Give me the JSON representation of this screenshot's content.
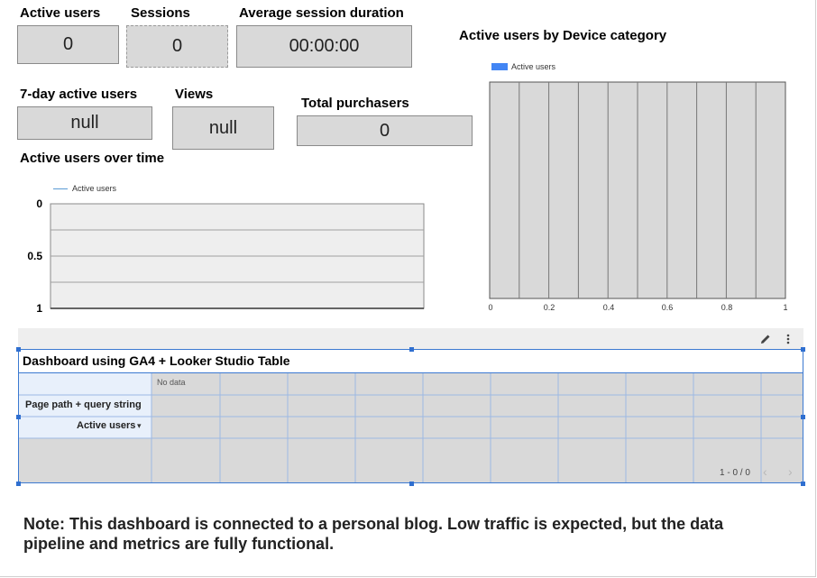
{
  "scorecards": {
    "active_users": {
      "label": "Active users",
      "value": "0"
    },
    "sessions": {
      "label": "Sessions",
      "value": "0"
    },
    "avg_session_duration": {
      "label": "Average session duration",
      "value": "00:00:00"
    },
    "seven_day_active_users": {
      "label": "7-day active users",
      "value": "null"
    },
    "views": {
      "label": "Views",
      "value": "null"
    },
    "total_purchasers": {
      "label": "Total purchasers",
      "value": "0"
    }
  },
  "line_chart": {
    "title": "Active users over time",
    "legend": "Active users",
    "y_ticks": [
      "0",
      "0.5",
      "1"
    ]
  },
  "bar_chart": {
    "title": "Active users by Device category",
    "legend": "Active users",
    "x_ticks": [
      "0",
      "0.2",
      "0.4",
      "0.6",
      "0.8",
      "1"
    ]
  },
  "table": {
    "title": "Dashboard using GA4 + Looker Studio Table",
    "no_data": "No data",
    "dimension_header": "Page path + query string",
    "metric_header": "Active users",
    "sort_indicator": "▾",
    "pagination": "1 - 0 / 0",
    "prev_icon": "chevron-left-icon",
    "next_icon": "chevron-right-icon",
    "edit_icon": "pencil-icon",
    "more_icon": "more-vert-icon"
  },
  "note": "Note: This dashboard is connected to a personal blog. Low traffic is expected, but the data pipeline and metrics are fully functional.",
  "colors": {
    "legend_blue": "#5b9bd5",
    "bar_legend_blue": "#4285f4",
    "selection_blue": "#3b79d1",
    "card_fill": "#d9d9d9"
  }
}
